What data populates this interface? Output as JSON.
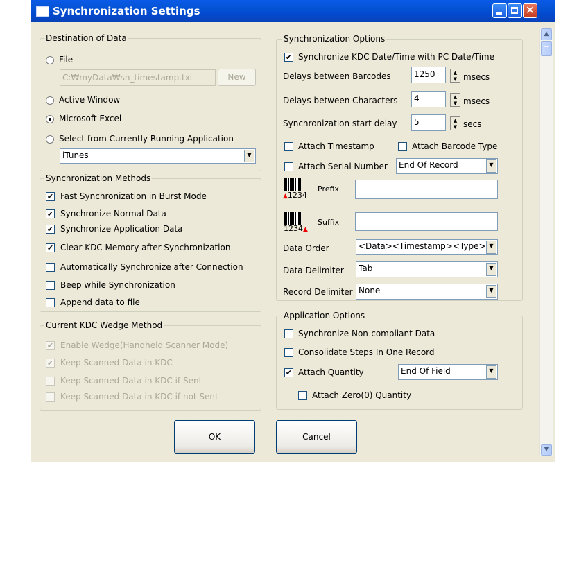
{
  "window": {
    "title": "Synchronization Settings",
    "colors": {
      "titlebar": "#0453d4",
      "face": "#ece9d8",
      "close": "#c4391c"
    }
  },
  "destination": {
    "legend": "Destination of Data",
    "file_label": "File",
    "file_path": "C:₩myData₩sn_timestamp.txt",
    "new_button": "New",
    "active_window_label": "Active Window",
    "excel_label": "Microsoft Excel",
    "running_app_label": "Select from Currently Running Application",
    "running_app_value": "iTunes",
    "selected": "Microsoft Excel"
  },
  "methods": {
    "legend": "Synchronization Methods",
    "items": [
      {
        "label": "Fast Synchronization in Burst Mode",
        "checked": true
      },
      {
        "label": "Synchronize Normal Data",
        "checked": true
      },
      {
        "label": "Synchronize Application Data",
        "checked": true
      },
      {
        "label": "Clear KDC Memory after Synchronization",
        "checked": true
      },
      {
        "label": "Automatically Synchronize after Connection",
        "checked": false
      },
      {
        "label": "Beep while Synchronization",
        "checked": false
      },
      {
        "label": "Append data to file",
        "checked": false
      }
    ]
  },
  "wedge": {
    "legend": "Current KDC Wedge Method",
    "items": [
      {
        "label": "Enable Wedge(Handheld Scanner Mode)",
        "checked": true
      },
      {
        "label": "Keep Scanned Data in KDC",
        "checked": true
      },
      {
        "label": "Keep Scanned Data in KDC if Sent",
        "checked": false
      },
      {
        "label": "Keep Scanned Data in KDC if not Sent",
        "checked": false
      }
    ]
  },
  "options": {
    "legend": "Synchronization Options",
    "sync_datetime_label": "Synchronize KDC Date/Time with PC Date/Time",
    "delay_barcodes_label": "Delays between Barcodes",
    "delay_barcodes_value": "1250",
    "delay_chars_label": "Delays between Characters",
    "delay_chars_value": "4",
    "start_delay_label": "Synchronization start delay",
    "start_delay_value": "5",
    "unit_msecs": "msecs",
    "unit_secs": "secs",
    "attach_timestamp_label": "Attach Timestamp",
    "attach_barcode_type_label": "Attach Barcode Type",
    "attach_serial_label": "Attach Serial Number",
    "serial_position": "End Of Record",
    "barcode_number": "1234",
    "prefix_label": "Prefix",
    "prefix_value": "",
    "suffix_label": "Suffix",
    "suffix_value": "",
    "data_order_label": "Data Order",
    "data_order_value": "<Data><Timestamp><Type>",
    "data_delimiter_label": "Data Delimiter",
    "data_delimiter_value": "Tab",
    "record_delimiter_label": "Record Delimiter",
    "record_delimiter_value": "None"
  },
  "app_options": {
    "legend": "Application Options",
    "noncompliant_label": "Synchronize Non-compliant Data",
    "consolidate_label": "Consolidate Steps In One Record",
    "attach_quantity_label": "Attach Quantity",
    "quantity_position": "End Of Field",
    "zero_quantity_label": "Attach Zero(0) Quantity"
  },
  "buttons": {
    "ok": "OK",
    "cancel": "Cancel"
  }
}
